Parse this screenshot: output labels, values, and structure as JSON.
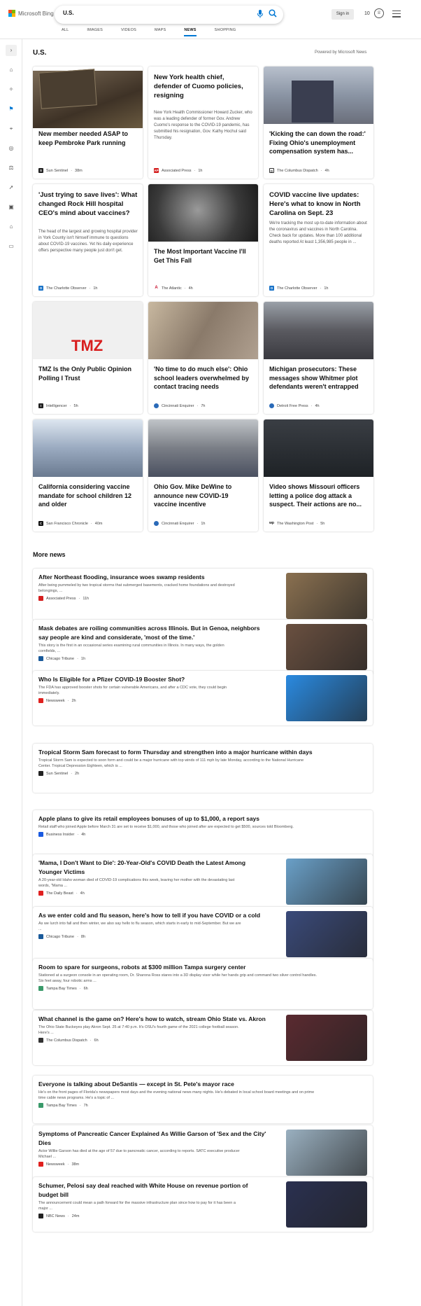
{
  "header": {
    "logo_text": "Microsoft Bing",
    "search_value": "U.S.",
    "sign_in": "Sign in",
    "points": "10",
    "tabs": [
      {
        "label": "ALL"
      },
      {
        "label": "IMAGES"
      },
      {
        "label": "VIDEOS"
      },
      {
        "label": "MAPS"
      },
      {
        "label": "NEWS"
      },
      {
        "label": "SHOPPING"
      }
    ],
    "active_tab": "NEWS"
  },
  "rail": {
    "icons": [
      "chevron-right-icon",
      "home-icon",
      "sparkle-icon",
      "flag-icon",
      "location-pin-icon",
      "globe-icon",
      "scale-icon",
      "rocket-icon",
      "film-icon",
      "bank-icon",
      "card-icon"
    ]
  },
  "section": {
    "title": "U.S.",
    "powered_by": "Powered by Microsoft News"
  },
  "cards": [
    {
      "title": "New member needed ASAP to keep Pembroke Park running",
      "desc": "",
      "source": "Sun Sentinel",
      "time": "38m",
      "src_color": "#222",
      "img_color": "#5a4a3a"
    },
    {
      "title": "New York health chief, defender of Cuomo policies, resigning",
      "desc": "New York Health Commissioner Howard Zucker, who was a leading defender of former Gov. Andrew Cuomo's response to the COVID-19 pandemic, has submitted his resignation, Gov. Kathy Hochul said Thursday.",
      "source": "Associated Press",
      "time": "1h",
      "src_color": "#d41e1e",
      "img_color": ""
    },
    {
      "title": "'Kicking the can down the road:' Fixing Ohio's unemployment compensation system has...",
      "desc": "",
      "source": "The Columbus Dispatch",
      "time": "4h",
      "src_color": "#333",
      "img_color": "#8a94a4"
    },
    {
      "title": "'Just trying to save lives': What changed Rock Hill hospital CEO's mind about vaccines?",
      "desc": "The head of the largest and growing hospital provider in York County isn't himself immune to questions about COVID-19 vaccines. Yet his daily experience offers perspective many people just don't get.",
      "source": "The Charlotte Observer",
      "time": "1h",
      "src_color": "#1a73c8",
      "img_color": ""
    },
    {
      "title": "The Most Important Vaccine I'll Get This Fall",
      "desc": "",
      "source": "The Atlantic",
      "time": "4h",
      "src_color": "#c8102e",
      "img_color": "#3a3a3a"
    },
    {
      "title": "COVID vaccine live updates: Here's what to know in North Carolina on Sept. 23",
      "desc": "We're tracking the most up-to-date information about the coronavirus and vaccines in North Carolina. Check back for updates. More than 100 additional deaths reported At least 1,356,985 people in ...",
      "source": "The Charlotte Observer",
      "time": "1h",
      "src_color": "#1a73c8",
      "img_color": ""
    },
    {
      "title": "TMZ Is the Only Public Opinion Polling I Trust",
      "desc": "",
      "source": "Intelligencer",
      "time": "5h",
      "src_color": "#222",
      "img_color": "#e8e8e8"
    },
    {
      "title": "'No time to do much else': Ohio school leaders overwhelmed by contact tracing needs",
      "desc": "",
      "source": "Cincinnati Enquirer",
      "time": "7h",
      "src_color": "#2a6ab8",
      "img_color": "#9a8a7a"
    },
    {
      "title": "Michigan prosecutors: These messages show Whitmer plot defendants weren't entrapped",
      "desc": "",
      "source": "Detroit Free Press",
      "time": "4h",
      "src_color": "#2a6ab8",
      "img_color": "#6a6a70"
    },
    {
      "title": "California considering vaccine mandate for school children 12 and older",
      "desc": "",
      "source": "San Francisco Chronicle",
      "time": "40m",
      "src_color": "#111",
      "img_color": "#7a8aa0"
    },
    {
      "title": "Ohio Gov. Mike DeWine to announce new COVID-19 vaccine incentive",
      "desc": "",
      "source": "Cincinnati Enquirer",
      "time": "1h",
      "src_color": "#2a6ab8",
      "img_color": "#8a8a8a"
    },
    {
      "title": "Video shows Missouri officers letting a police dog attack a suspect. Their actions are no...",
      "desc": "",
      "source": "The Washington Post",
      "time": "5h",
      "src_color": "#111",
      "img_color": "#2a2e34"
    }
  ],
  "more_news": {
    "title": "More news",
    "items": [
      {
        "title": "After Northeast flooding, insurance woes swamp residents",
        "title2": "",
        "desc": "After being pummeled by two tropical storms that submerged basements, cracked home foundations and destroyed",
        "desc2": "belongings, ...",
        "source": "Associated Press",
        "time": "11h",
        "src_color": "#d41e1e",
        "has_img": true,
        "img_color": "#8a7050"
      },
      {
        "title": "Mask debates are roiling communities across Illinois. But in Genoa, neighbors",
        "title2": "say people are kind and considerate, 'most of the time.'",
        "desc": "This story is the first in an occasional series examining rural communities in Illinois. In many ways, the golden",
        "desc2": "cornfields, ...",
        "source": "Chicago Tribune",
        "time": "1h",
        "src_color": "#1a5a9a",
        "has_img": true,
        "img_color": "#6a5040"
      },
      {
        "title": "Who Is Eligible for a Pfizer COVID-19 Booster Shot?",
        "title2": "",
        "desc": "The FDA has approved booster shots for certain vulnerable Americans, and after a CDC vote, they could begin",
        "desc2": "immediately.",
        "source": "Newsweek",
        "time": "2h",
        "src_color": "#e0201e",
        "has_img": true,
        "img_color": "#2a8ae0"
      },
      {
        "title": "Tropical Storm Sam forecast to form Thursday and strengthen into a major hurricane within days",
        "title2": "",
        "desc": "Tropical Storm Sam is expected to soon form and could be a major hurricane with top winds of 111 mph by late Monday, according to the National Hurricane",
        "desc2": "Center. Tropical Depression Eighteen, which is ...",
        "source": "Sun Sentinel",
        "time": "2h",
        "src_color": "#222",
        "has_img": false,
        "img_color": ""
      },
      {
        "title": "Apple plans to give its retail employees bonuses of up to $1,000, a report says",
        "title2": "",
        "desc": "Retail staff who joined Apple before March 31 are set to receive $1,000, and those who joined after are expected to get $500, sources told Bloomberg.",
        "desc2": "",
        "source": "Business Insider",
        "time": "4h",
        "src_color": "#1a5ae0",
        "has_img": false,
        "img_color": ""
      },
      {
        "title": "'Mama, I Don't Want to Die': 20-Year-Old's COVID Death the Latest Among",
        "title2": "Younger Victims",
        "desc": "A 20-year-old Idaho woman died of COVID-19 complications this week, leaving her mother with the devastating last",
        "desc2": "words, \"Mama ...",
        "source": "The Daily Beast",
        "time": "4h",
        "src_color": "#e02020",
        "has_img": true,
        "img_color": "#6aa0c8"
      },
      {
        "title": "As we enter cold and flu season, here's how to tell if you have COVID or a cold",
        "title2": "",
        "desc": "As we lurch into fall and then winter, we also say hello to flu season, which starts in early to mid-September. But we are",
        "desc2": "...",
        "source": "Chicago Tribune",
        "time": "8h",
        "src_color": "#1a5a9a",
        "has_img": true,
        "img_color": "#3a4a7a"
      },
      {
        "title": "Room to spare for surgeons, robots at $300 million Tampa surgery center",
        "title2": "",
        "desc": "Stationed at a surgeon console in an operating room, Dr. Sharona Ross stares into a 3D display visor while her hands grip and command two silver control handles.",
        "desc2": "Six feet away, four robotic arms ...",
        "source": "Tampa Bay Times",
        "time": "6h",
        "src_color": "#3a9a6a",
        "has_img": false,
        "img_color": ""
      },
      {
        "title": "What channel is the game on? Here's how to watch, stream Ohio State vs. Akron",
        "title2": "",
        "desc": "The Ohio State Buckeyes play Akron Sept. 25 at 7:40 p.m. It's OSU's fourth game of the 2021 college football season.",
        "desc2": "Here's ...",
        "source": "The Columbus Dispatch",
        "time": "6h",
        "src_color": "#333",
        "has_img": true,
        "img_color": "#5a2a30"
      },
      {
        "title": "Everyone is talking about DeSantis — except in St. Pete's mayor race",
        "title2": "",
        "desc": "He's on the front pages of Florida's newspapers most days and the evening national news many nights. He's debated in local school board meetings and on prime",
        "desc2": "time cable news programs. He's a topic of ...",
        "source": "Tampa Bay Times",
        "time": "7h",
        "src_color": "#3a9a6a",
        "has_img": false,
        "img_color": ""
      },
      {
        "title": "Symptoms of Pancreatic Cancer Explained As Willie Garson of 'Sex and the City'",
        "title2": "Dies",
        "desc": "Actor Willie Garson has died at the age of 57 due to pancreatic cancer, according to reports. SATC executive producer",
        "desc2": "Michael ...",
        "source": "Newsweek",
        "time": "38m",
        "src_color": "#e0201e",
        "has_img": true,
        "img_color": "#9ab0c0"
      },
      {
        "title": "Schumer, Pelosi say deal reached with White House on revenue portion of",
        "title2": "budget bill",
        "desc": "The announcement could mean a path forward for the massive infrastructure plan since how to pay for it has been a",
        "desc2": "major ...",
        "source": "NBC News",
        "time": "24m",
        "src_color": "#222",
        "has_img": true,
        "img_color": "#2a3050"
      }
    ]
  }
}
